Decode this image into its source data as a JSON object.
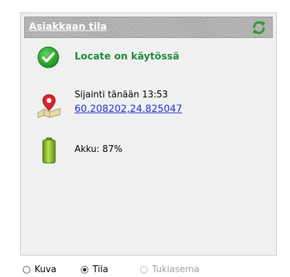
{
  "header": {
    "title": "Asiakkaan tila",
    "refresh_icon": "refresh-icon"
  },
  "status": {
    "icon": "check-circle-icon",
    "text": "Locate on käytössä",
    "color": "#1f8a3a"
  },
  "location": {
    "icon": "map-pin-icon",
    "label": "Sijainti tänään 13:53",
    "coordinates": "60.208202,24.825047",
    "link_color": "#1a2ee0"
  },
  "battery": {
    "icon": "battery-icon",
    "text": "Akku: 87%",
    "level": 0.87
  },
  "view_options": [
    {
      "label": "Kuva",
      "checked": false,
      "enabled": true
    },
    {
      "label": "Tila",
      "checked": true,
      "enabled": true
    },
    {
      "label": "Tukiasema",
      "checked": false,
      "enabled": false
    }
  ]
}
